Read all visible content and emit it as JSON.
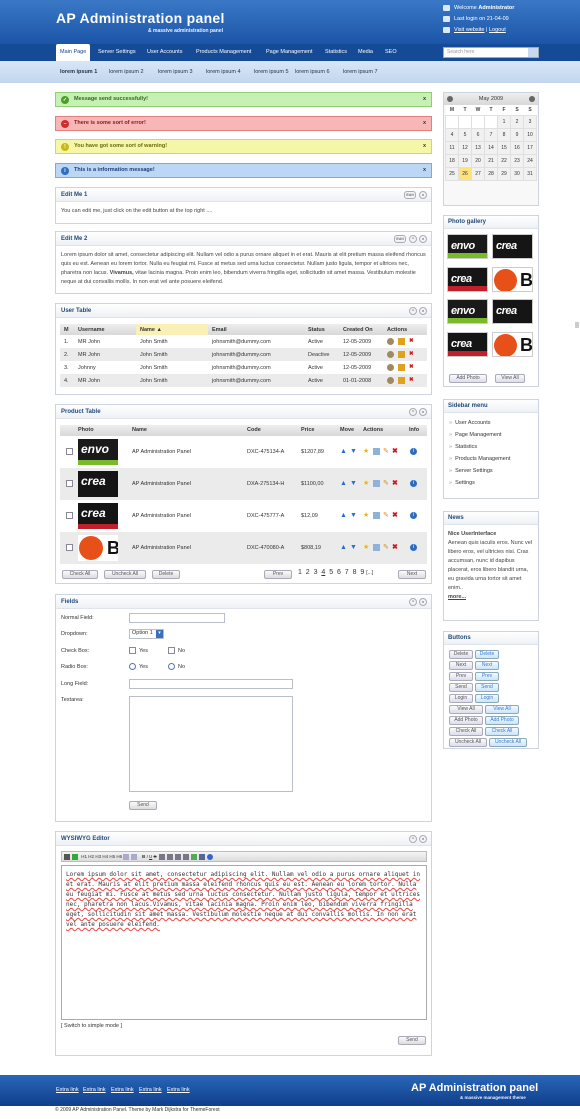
{
  "header": {
    "logo": "AP  Administration panel",
    "tagline": "& massive administration panel",
    "welcome_prefix": "Welcome ",
    "welcome_user": "Administrator",
    "last_login": "Last login on 21-04-09",
    "visit": "Visit website",
    "logout": "Logout"
  },
  "nav": {
    "items": [
      "Main Page",
      "Server Settings",
      "User Accounts",
      "Products Management",
      "Page Management",
      "Statistics",
      "Media",
      "SEO"
    ],
    "search_placeholder": "Search here"
  },
  "subnav": [
    "lorem ipsum 1",
    "lorem ipsum 2",
    "lorem ipsum 3",
    "lorem ipsum 4",
    "lorem ipsum 5",
    "lorem ipsum 6",
    "lorem ipsum 7"
  ],
  "messages": {
    "success": "Message send successfully!",
    "error": "There is some sort of error!",
    "warning": "You have got some sort of warning!",
    "info": "This is a information message!",
    "close": "x"
  },
  "edit1": {
    "title": "Edit Me 1",
    "edit": "Edit",
    "text": "You can edit me, just click on the edit button at the top right ...."
  },
  "edit2": {
    "title": "Edit Me 2",
    "edit": "Edit",
    "text_a": "Lorem ipsum dolor sit amet, consectetur adipiscing elit. Nullam vel odio a purus ornare aliquet in et erat. Mauris at elit pretium massa eleifend rhoncus quis eu est. Aenean eu lorem tortor. Nulla eu feugiat mi. Fusce at metus sed urna luctus consectetur. Nullam justo ligula, tempor et ultrices nec, pharetra non lacus.",
    "bold": "Vivamus,",
    "text_b": " vitae lacinia magna. Proin enim leo, bibendum viverra fringilla eget, sollicitudin sit amet massa. Vestibulum molestie neque at dui convallis mollis. In non erat vel ante posuere eleifend."
  },
  "user_table": {
    "title": "User Table",
    "headers": [
      "M",
      "Username",
      "Name ▲",
      "Email",
      "Status",
      "Created On",
      "Actions"
    ],
    "rows": [
      [
        "1.",
        "MR John",
        "John Smith",
        "johnsmith@dummy.com",
        "Active",
        "12-05-2009"
      ],
      [
        "2.",
        "MR John",
        "John Smith",
        "johnsmith@dummy.com",
        "Deactive",
        "12-05-2009"
      ],
      [
        "3.",
        "Johnny",
        "John Smith",
        "johnsmith@dummy.com",
        "Active",
        "12-05-2009"
      ],
      [
        "4.",
        "MR John",
        "John Smith",
        "johnsmith@dummy.com",
        "Active",
        "01-01-2008"
      ]
    ]
  },
  "product_table": {
    "title": "Product Table",
    "headers": [
      "Photo",
      "Name",
      "Code",
      "Price",
      "Move",
      "Actions",
      "Info"
    ],
    "rows": [
      [
        "AP Administration Panel",
        "DXC-475134-A",
        "$1207,89"
      ],
      [
        "AP Administration Panel",
        "DXA-275134-H",
        "$1100,00"
      ],
      [
        "AP Administration Panel",
        "DXC-475777-A",
        "$12,09"
      ],
      [
        "AP Administration Panel",
        "DXC-470080-A",
        "$808,19"
      ]
    ],
    "check_all": "Check All",
    "uncheck_all": "Uncheck All",
    "delete": "Delete",
    "prev": "Prev",
    "next": "Next",
    "pages": [
      "1",
      "2",
      "3",
      "4",
      "5",
      "6",
      "7",
      "8",
      "9",
      "[...]"
    ]
  },
  "fields": {
    "title": "Fields",
    "normal": "Normal Field:",
    "dropdown": "Dropdown:",
    "dropdown_value": "Option 1",
    "checkbox": "Check Box:",
    "radio": "Radio Box:",
    "long": "Long Field:",
    "textarea": "Textarea:",
    "yes": "Yes",
    "no": "No",
    "send": "Send"
  },
  "wysiwyg": {
    "title": "WYSIWYG Editor",
    "content": "Lorem ipsum dolor sit amet, consectetur adipiscing elit. Nullam vel odio a purus ornare aliquet in et erat. Mauris at elit pretium massa eleifend rhoncus quis eu est. Aenean eu lorem tortor. Nulla eu feugiat mi. Fusce at metus sed urna luctus consectetur. Nullam justo ligula, tempor et ultrices nec, pharetra non lacus.Vivamus, vitae lacinia magna. Proin enim leo, bibendum viverra fringilla eget, sollicitudin sit amet massa. Vestibulum molestie neque at dui convallis mollis. In non erat vel ante posuere eleifend.",
    "switch": "[ Switch to simple mode ]",
    "send": "Send",
    "toolbar": [
      "H1",
      "H2",
      "H3",
      "H4",
      "H5",
      "H6"
    ]
  },
  "calendar": {
    "month": "May 2009",
    "days": [
      "M",
      "T",
      "W",
      "T",
      "F",
      "S",
      "S"
    ],
    "weeks": [
      [
        "",
        "",
        "",
        "",
        "1",
        "2",
        "3"
      ],
      [
        "4",
        "5",
        "6",
        "7",
        "8",
        "9",
        "10"
      ],
      [
        "11",
        "12",
        "13",
        "14",
        "15",
        "16",
        "17"
      ],
      [
        "18",
        "19",
        "20",
        "21",
        "22",
        "23",
        "24"
      ],
      [
        "25",
        "26",
        "27",
        "28",
        "29",
        "30",
        "31"
      ]
    ]
  },
  "gallery": {
    "title": "Photo gallery",
    "add": "Add Photo",
    "view": "View All",
    "logo_text_1": "envo",
    "logo_text_2": "crea"
  },
  "sidebar_menu": {
    "title": "Sidebar menu",
    "items": [
      "User Accounts",
      "Page Management",
      "Statistics",
      "Products Management",
      "Server Settings",
      "Settings"
    ]
  },
  "news": {
    "title": "News",
    "headline": "Nice UserInterface",
    "text": "Aenean quis iaculis eros. Nunc vel libero eros, vel ultricies nisi. Cras accumsan, nunc id dapibus placerat, eros libero blandit urna, eu gravida urna tortor sit amet enim..",
    "more": "more..."
  },
  "buttons": {
    "title": "Buttons",
    "pairs": [
      [
        "Delete",
        "Delete"
      ],
      [
        "Next",
        "Next"
      ],
      [
        "Prev",
        "Prev"
      ],
      [
        "Send",
        "Send"
      ],
      [
        "Login",
        "Login"
      ],
      [
        "View All",
        "View All"
      ],
      [
        "Add Photo",
        "Add Photo"
      ],
      [
        "Check All",
        "Check All"
      ],
      [
        "Uncheck All",
        "Uncheck All"
      ]
    ]
  },
  "footer": {
    "links": [
      "Extra link",
      "Extra link",
      "Extra link",
      "Extra link",
      "Extra link"
    ],
    "logo": "AP  Administration panel",
    "tagline": "& massive management theme",
    "copyright": "© 2009 AP Administration Panel. Theme by Mark Dijkstra for ThemeForest"
  },
  "colors": {
    "brand_blue": "#1c55a8",
    "success_bg": "#c6f0b4",
    "error_bg": "#f7b7b7",
    "warning_bg": "#f6f7a6",
    "info_bg": "#bcd6f6"
  }
}
